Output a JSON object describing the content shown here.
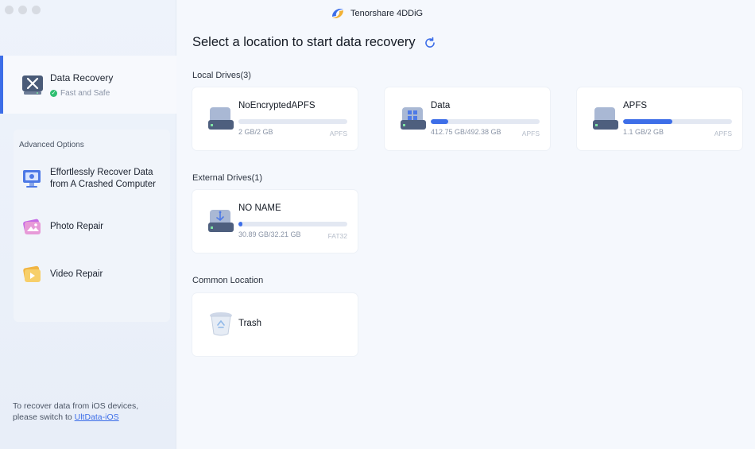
{
  "app": {
    "title": "Tenorshare 4DDiG"
  },
  "sidebar": {
    "primary": {
      "title": "Data Recovery",
      "subtitle": "Fast and Safe"
    },
    "advanced": {
      "title": "Advanced Options",
      "items": [
        {
          "label_line1": "Effortlessly Recover Data",
          "label_line2": "from A Crashed Computer",
          "icon": "crashed-computer-icon"
        },
        {
          "label_line1": "Photo Repair",
          "icon": "photo-repair-icon"
        },
        {
          "label_line1": "Video Repair",
          "icon": "video-repair-icon"
        }
      ]
    },
    "ios_note": {
      "text_line1": "To recover data from iOS devices,",
      "text_line2_prefix": "please switch to ",
      "link": "UltData-iOS"
    }
  },
  "main": {
    "title": "Select a location to start data recovery",
    "local_drives": {
      "label": "Local Drives(3)",
      "drives": [
        {
          "name": "NoEncryptedAPFS",
          "size": "2 GB/2 GB",
          "fs": "APFS",
          "used_fraction": 0.0
        },
        {
          "name": "Data",
          "size": "412.75 GB/492.38 GB",
          "fs": "APFS",
          "used_fraction": 0.16
        },
        {
          "name": "APFS",
          "size": "1.1 GB/2 GB",
          "fs": "APFS",
          "used_fraction": 0.45
        }
      ]
    },
    "external_drives": {
      "label": "External Drives(1)",
      "drives": [
        {
          "name": "NO NAME",
          "size": "30.89 GB/32.21 GB",
          "fs": "FAT32",
          "used_fraction": 0.04
        }
      ]
    },
    "common_location": {
      "label": "Common Location",
      "items": [
        {
          "name": "Trash"
        }
      ]
    }
  },
  "colors": {
    "accent": "#3d6ee8",
    "success": "#2fbf71"
  }
}
